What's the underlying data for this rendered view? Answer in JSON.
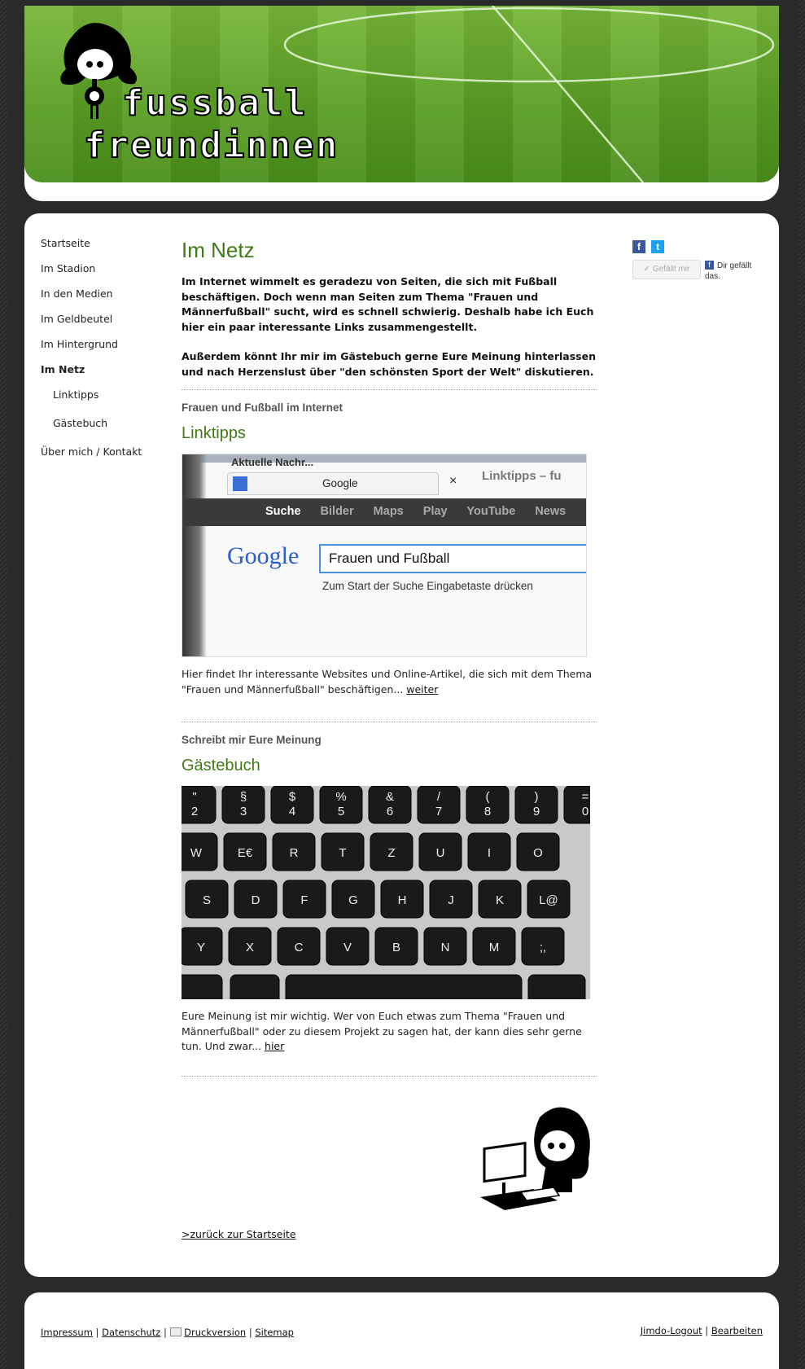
{
  "header": {
    "logo_word_1": "fussball",
    "logo_word_2": "freundinnen"
  },
  "nav": {
    "items": [
      {
        "label": "Startseite"
      },
      {
        "label": "Im Stadion"
      },
      {
        "label": "In den Medien"
      },
      {
        "label": "Im Geldbeutel"
      },
      {
        "label": "Im Hintergrund"
      },
      {
        "label": "Im Netz"
      },
      {
        "label": "Linktipps"
      },
      {
        "label": "Gästebuch"
      },
      {
        "label": "Über mich / Kontakt"
      }
    ]
  },
  "main": {
    "title": "Im Netz",
    "intro_1": "Im Internet wimmelt es geradezu von Seiten, die sich mit Fußball beschäftigen. Doch wenn man Seiten zum Thema \"Frauen und Männerfußball\" sucht, wird es schnell schwierig. Deshalb habe ich Euch hier ein paar interessante Links zusammengestellt.",
    "intro_2": "Außerdem könnt Ihr mir im Gästebuch gerne Eure Meinung hinterlassen und nach Herzenslust über \"den schönsten Sport der Welt\" diskutieren.",
    "section1": {
      "kicker": "Frauen und Fußball im Internet",
      "heading": "Linktipps",
      "desc": "Hier findet Ihr interessante Websites und Online-Artikel, die sich mit dem Thema \"Frauen und Männerfußball\" beschäftigen... ",
      "link": "weiter",
      "image": {
        "tab1": "Aktuelle Nachr...",
        "tab2": "Google",
        "tab3": "Linktipps – fu",
        "tab_close": "×",
        "menu": [
          "Suche",
          "Bilder",
          "Maps",
          "Play",
          "YouTube",
          "News"
        ],
        "logo": "Google",
        "query": "Frauen und Fußball",
        "hint": "Zum Start der Suche Eingabetaste drücken"
      }
    },
    "section2": {
      "kicker": "Schreibt mir Eure Meinung",
      "heading": "Gästebuch",
      "desc": "Eure Meinung ist mir wichtig. Wer von Euch etwas zum Thema \"Frauen und Männerfußball\" oder zu diesem Projekt zu sagen hat, der kann dies sehr gerne tun. Und zwar... ",
      "link": "hier",
      "image": {
        "row1_top": [
          "\"",
          "§",
          "$",
          "%",
          "&",
          "/",
          "(",
          ")",
          "="
        ],
        "row1_bottom": [
          "2",
          "3",
          "4",
          "5",
          "6",
          "7",
          "8",
          "9",
          "0"
        ],
        "row2": [
          "W",
          "E€",
          "R",
          "T",
          "Z",
          "U",
          "I",
          "O"
        ],
        "row3": [
          "S",
          "D",
          "F",
          "G",
          "H",
          "J",
          "K",
          "L@"
        ],
        "row4": [
          "Y",
          "X",
          "C",
          "V",
          "B",
          "N",
          "M",
          ";,"
        ]
      }
    },
    "back_link": ">zurück zur Startseite"
  },
  "social": {
    "fb_letter": "f",
    "tw_letter": "t",
    "like_button": "✓ Gefällt mir",
    "fb_square": "f",
    "like_text": "Dir gefällt das."
  },
  "footer": {
    "impressum": "Impressum",
    "datenschutz": "Datenschutz",
    "druckversion": "Druckversion",
    "sitemap": "Sitemap",
    "sep": "|",
    "logout": "Jimdo-Logout",
    "bearbeiten": "Bearbeiten"
  },
  "colors": {
    "accent_green": "#3f7a14",
    "facebook": "#3b5998",
    "twitter": "#1da1f2",
    "background": "#2c2c2c"
  }
}
